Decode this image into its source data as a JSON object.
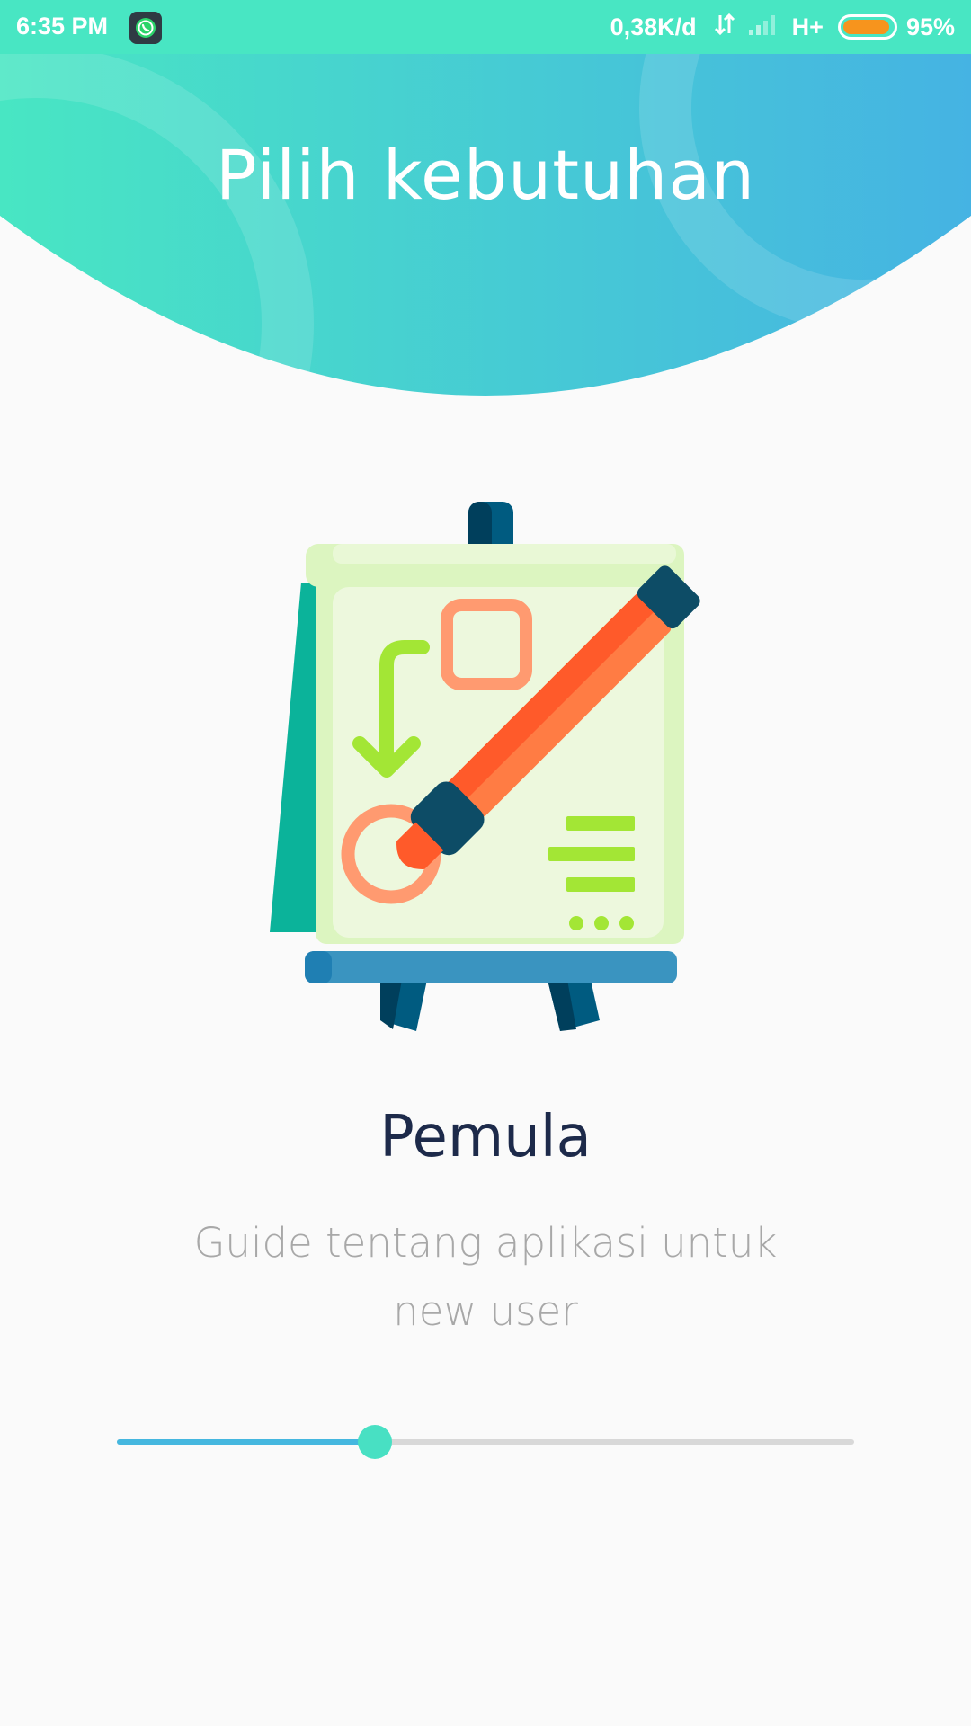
{
  "status_bar": {
    "time": "6:35 PM",
    "notification_icon": "whatsapp-icon",
    "net_speed": "0,38K/d",
    "data_icon": "data-transfer-icon",
    "signal_icon": "signal-icon",
    "network_type": "H+",
    "battery_level": 0.95,
    "battery_percent": "95%",
    "battery_color": "#f7941d"
  },
  "header": {
    "title": "Pilih kebutuhan",
    "gradient_start": "#48e6c3",
    "gradient_end": "#45b3e3"
  },
  "card": {
    "illustration_icon": "presentation-easel-marker-icon",
    "title": "Pemula",
    "description": "Guide tentang aplikasi untuk new user"
  },
  "slider": {
    "value": 0.35,
    "fill_color": "#45b7df",
    "thumb_color": "#48e0c3",
    "track_color": "#d8d8d8"
  }
}
